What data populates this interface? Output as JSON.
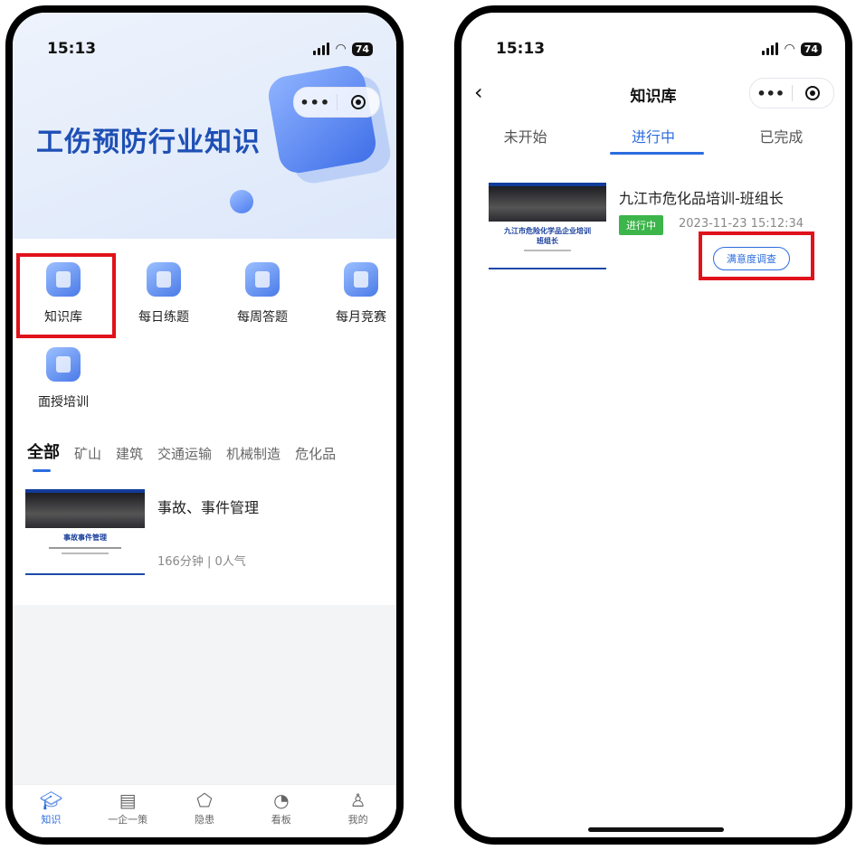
{
  "status": {
    "time_left": "15:13",
    "time_right": "15:13",
    "battery": "74"
  },
  "phoneA": {
    "hero_title": "工伤预防行业知识",
    "capsule_more": "•••",
    "grid": [
      {
        "label": "知识库",
        "icon": "play-icon"
      },
      {
        "label": "每日练题",
        "icon": "document-icon"
      },
      {
        "label": "每周答题",
        "icon": "edit-icon"
      },
      {
        "label": "每月竞赛",
        "icon": "medal-icon"
      },
      {
        "label": "面授培训",
        "icon": "person-icon"
      }
    ],
    "category_tabs": [
      "全部",
      "矿山",
      "建筑",
      "交通运输",
      "机械制造",
      "危化品"
    ],
    "course": {
      "title": "事故、事件管理",
      "thumb_caption": "事故事件管理",
      "meta": "166分钟 | 0人气"
    },
    "tabbar": [
      {
        "label": "知识",
        "icon": "graduation-cap-icon",
        "active": true
      },
      {
        "label": "一企一策",
        "icon": "building-icon",
        "active": false
      },
      {
        "label": "隐患",
        "icon": "warning-icon",
        "active": false
      },
      {
        "label": "看板",
        "icon": "pie-chart-icon",
        "active": false
      },
      {
        "label": "我的",
        "icon": "user-icon",
        "active": false
      }
    ]
  },
  "phoneB": {
    "back": "‹",
    "title": "知识库",
    "capsule_more": "•••",
    "tabs": [
      "未开始",
      "进行中",
      "已完成"
    ],
    "active_tab": "进行中",
    "course": {
      "title": "九江市危化品培训-班组长",
      "thumb_caption_1": "九江市危险化学品企业培训",
      "thumb_caption_2": "班组长",
      "status": "进行中",
      "datetime": "2023-11-23 15:12:34",
      "survey_button": "满意度调查"
    }
  },
  "colors": {
    "accent": "#2b6de0",
    "highlight": "#e0121b",
    "status_green": "#3cb54a"
  }
}
